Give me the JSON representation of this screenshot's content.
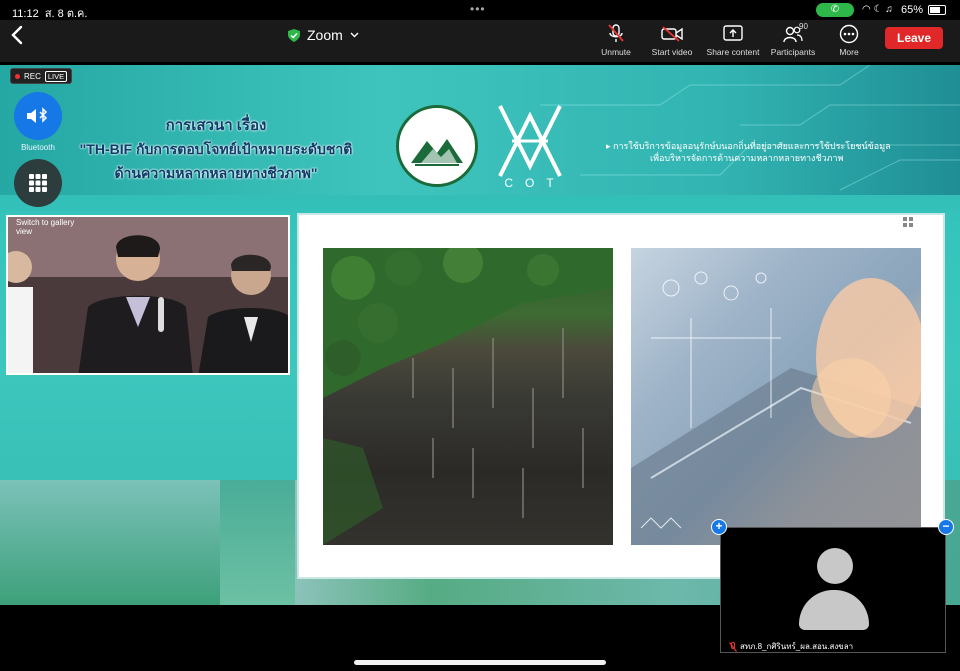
{
  "status_bar": {
    "time": "11:12",
    "date": "ส. 8 ต.ค.",
    "battery": "65%"
  },
  "toolbar": {
    "app_title": "Zoom",
    "unmute_label": "Unmute",
    "start_video_label": "Start video",
    "share_content_label": "Share content",
    "participants_label": "Participants",
    "participants_count": "90",
    "more_label": "More",
    "leave_label": "Leave"
  },
  "meeting": {
    "rec_label": "REC",
    "live_label": "LIVE",
    "bluetooth_label": "Bluetooth",
    "gallery_label": "Switch to gallery view"
  },
  "slide": {
    "title_line1": "การเสวนา เรื่อง",
    "title_line2": "\"TH-BIF กับการตอบโจทย์เป้าหมายระดับชาติ",
    "title_line3": "ด้านความหลากหลายทางชีวภาพ\"",
    "cot_text": "COT",
    "right_line1": "▸ การใช้บริการข้อมูลอนุรักษ์บนอกถิ่นที่อยู่อาศัยและการใช้ประโยชน์ข้อมูล",
    "right_line2": "เพื่อบริหารจัดการด้านความหลากหลายทางชีวภาพ"
  },
  "self_view": {
    "name": "สทภ.8_กศิรินทร์_ผล.สอน.สงขลา"
  },
  "colors": {
    "leave": "#e02828",
    "accent_blue": "#1677e6",
    "teal": "#3cc7bd",
    "rec_dot": "#e33333"
  }
}
